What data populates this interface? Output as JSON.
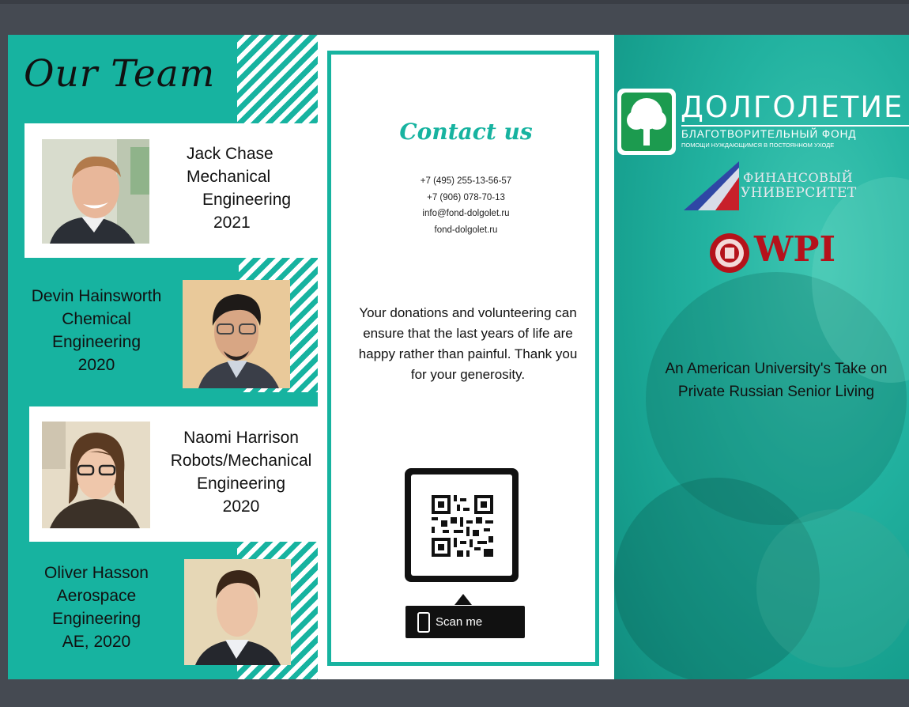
{
  "team": {
    "title": "Our Team",
    "members": [
      {
        "line1": "Jack Chase",
        "line2": "Mechanical",
        "line3": "Engineering",
        "line4": "2021"
      },
      {
        "line1": "Devin Hainsworth",
        "line2": "Chemical",
        "line3": "Engineering",
        "line4": "2020"
      },
      {
        "line1": "Naomi Harrison",
        "line2": "Robots/Mechanical",
        "line3": "Engineering",
        "line4": "2020"
      },
      {
        "line1": "Oliver Hasson",
        "line2": "Aerospace",
        "line3": "Engineering",
        "line4": "AE, 2020"
      }
    ]
  },
  "contact": {
    "title": "Contact us",
    "phone1": "+7 (495) 255-13-56-57",
    "phone2": "+7 (906) 078-70-13",
    "email": "info@fond-dolgolet.ru",
    "website": "fond-dolgolet.ru",
    "donation_message": "Your donations and volunteering can ensure that the last years of life are happy rather than painful. Thank you for your generosity.",
    "scan_label": "Scan me"
  },
  "cover": {
    "logo1_name": "ДОЛГОЛЕТИЕ",
    "logo1_line2": "БЛАГОТВОРИТЕЛЬНЫЙ ФОНД",
    "logo1_line3": "ПОМОЩИ НУЖДАЮЩИМСЯ В ПОСТОЯННОМ УХОДЕ",
    "logo2_line1": "ФИНАНСОВЫЙ",
    "logo2_line2": "УНИВЕРСИТЕТ",
    "logo3_name": "WPI",
    "tagline": "An American University's Take on Private Russian Senior Living"
  },
  "colors": {
    "teal": "#17b3a0",
    "dark": "#454a52",
    "wpi_red": "#b5121b"
  }
}
